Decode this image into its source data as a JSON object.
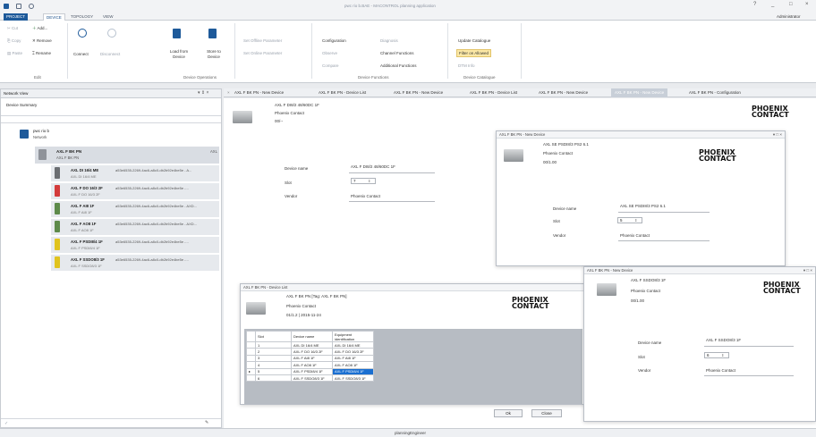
{
  "window": {
    "title": "pwc rio b.BAE - MACONTROL planning application",
    "user": "Administrator",
    "controls": [
      "?",
      "_",
      "□",
      "×"
    ]
  },
  "menu_tabs": [
    "PROJECT",
    "DEVICE",
    "TOPOLOGY",
    "VIEW"
  ],
  "active_menu_tab": "DEVICE",
  "ribbon": {
    "edit": {
      "cut": "Cut",
      "copy": "Copy",
      "paste": "Paste",
      "add": "Add...",
      "remove": "Remove",
      "rename": "Rename",
      "label": "Edit"
    },
    "device_operations": {
      "connect": "Connect",
      "disconnect": "Disconnect",
      "load_from_device": "Load from Device",
      "store_to_device": "Store to Device",
      "label": "Device Operations"
    },
    "offline": {
      "set_offline": "Set Offline Parameter",
      "set_online": "Set Online Parameter"
    },
    "device_functions": {
      "configuration": "Configuration",
      "observe": "Observe",
      "compare": "Compare",
      "diagnosis": "Diagnosis",
      "channel_functions": "Channel Functions",
      "additional_functions": "Additional Functions",
      "label": "Device Functions"
    },
    "device_catalogue": {
      "update": "Update Catalogue",
      "filter": "Filter on Allowed",
      "dtm_info": "DTM Info",
      "label": "Device Catalogue"
    }
  },
  "network_view": {
    "title": "Network View",
    "panel_controls": "▾ ⇕ ×",
    "summary_tab": "Device Summary",
    "root": {
      "name": "pwc rio b",
      "type": "Network"
    },
    "coupler": {
      "name": "AXL F BK PN",
      "sub": "AXL F BK PN",
      "tag": "AXL"
    },
    "modules": [
      {
        "name": "AXL DI 16/4 ME",
        "sub": "AXL DI 16/4 ME",
        "guid": "a53e6535-2269-4ac6-a8c0-db2b92e4be5e - A...",
        "color": "#6b6e72"
      },
      {
        "name": "AXL F DO 16/3 2F",
        "sub": "AXL F DO 16/3 2F",
        "guid": "a53e6535-2269-4ac6-a8c0-db2b92e4be5e -...",
        "color": "#d33b3b"
      },
      {
        "name": "AXL F AI8 1F",
        "sub": "AXL F AI8 1F",
        "guid": "a53e6535-2269-4ac6-a8c0-db2b92e4be5e - AXD...",
        "color": "#5d8a4a"
      },
      {
        "name": "AXL F AO8 1F",
        "sub": "AXL F AO8 1F",
        "guid": "a53e6535-2269-4ac6-a8c0-db2b92e4be5e - AXD...",
        "color": "#5d8a4a"
      },
      {
        "name": "AXL F PSDI8/4 1F",
        "sub": "AXL F PSDI8/4 1F",
        "guid": "a53e6535-2269-4ac6-a8c0-db2b92e4be5e -...",
        "color": "#e0c31e"
      },
      {
        "name": "AXL F SSDO8/3 1F",
        "sub": "AXL F SSDO8/3 1F",
        "guid": "a53e6535-2269-4ac6-a8c0-db2b92e4be5e -...",
        "color": "#e0c31e"
      }
    ]
  },
  "doc_tabs": [
    "AXL F BK PN - New Device",
    "AXL F BK PN - Device List",
    "AXL F BK PN - New Device",
    "AXL F BK PN - Device List",
    "AXL F BK PN - New Device",
    "AXL F BK PN - New Device",
    "AXL F BK PN - Configuration"
  ],
  "main_device": {
    "name": "AXL F DI8/2 48/60DC 1F",
    "vendor_header": "Phoenix Contact",
    "version": "00/--",
    "device_name_label": "Device name",
    "device_name_value": "AXL F DI8/2 48/60DC 1F",
    "slot_label": "Slot",
    "slot_value": "7",
    "vendor_label": "Vendor",
    "vendor_value": "Phoenix Contact"
  },
  "win_psdi": {
    "title": "AXL F BK PN - New Device",
    "name": "AXL SE PSDI8/3 PS2 6.1",
    "vendor_header": "Phoenix Contact",
    "version": "00/1.00",
    "device_name_label": "Device name",
    "device_name_value": "AXL SE PSDI8/3 PS2 6.1",
    "slot_label": "Slot",
    "slot_value": "5",
    "vendor_label": "Vendor",
    "vendor_value": "Phoenix Contact"
  },
  "win_list": {
    "title": "AXL F BK PN - Device List",
    "header_name": "AXL F BK PN [Tag: AXL F BK PN]",
    "vendor_header": "Phoenix Contact",
    "version": "01/1.2 | 2015-11-24",
    "columns": [
      "Slot",
      "Device name",
      "Equipment identification"
    ],
    "rows": [
      {
        "slot": "1",
        "name": "AXL DI 16/4 ME",
        "eq": "AXL DI 16/4 ME"
      },
      {
        "slot": "2",
        "name": "AXL F DO 16/3 2F",
        "eq": "AXL F DO 16/3 2F"
      },
      {
        "slot": "3",
        "name": "AXL F AI8 1F",
        "eq": "AXL F AI8 1F"
      },
      {
        "slot": "4",
        "name": "AXL F AO8 1F",
        "eq": "AXL F AO8 1F"
      },
      {
        "slot": "5",
        "name": "AXL F PSDI8/4 1F",
        "eq": "AXL F PSDI8/4 1F"
      },
      {
        "slot": "6",
        "name": "AXL F SSDO8/3 1F",
        "eq": "AXL F SSDO8/3 1F"
      }
    ],
    "selected_row": 4
  },
  "win_ssdo": {
    "title": "AXL F BK PN - New Device",
    "name": "AXL F SSDO8/3 1F",
    "vendor_header": "Phoenix Contact",
    "version": "00/1.00",
    "device_name_label": "Device name",
    "device_name_value": "AXL F SSDO8/3 1F",
    "slot_label": "Slot",
    "slot_value": "6",
    "vendor_label": "Vendor",
    "vendor_value": "Phoenix Contact"
  },
  "logo": {
    "line1": "PHOENIX",
    "line2": "CONTACT"
  },
  "buttons": {
    "ok": "Ok",
    "close": "Close"
  },
  "status": {
    "user_role": "planningEngineer"
  },
  "accent": "#1e5a9a"
}
